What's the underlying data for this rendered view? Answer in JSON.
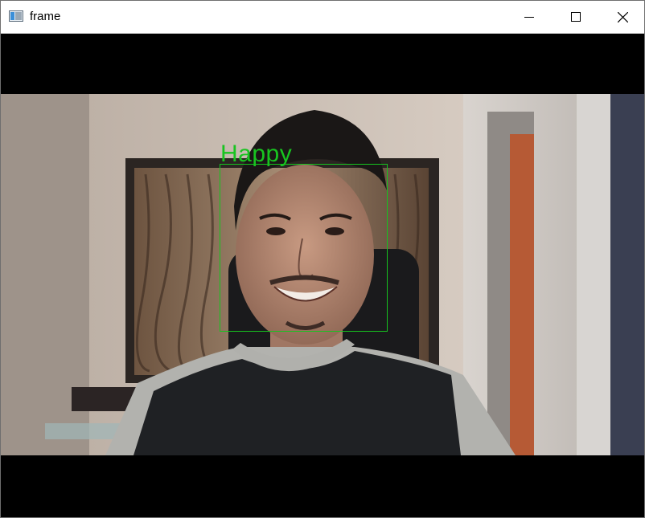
{
  "window": {
    "title": "frame",
    "icon": "opencv-window-icon"
  },
  "controls": {
    "minimize_icon": "minimize-icon",
    "maximize_icon": "maximize-icon",
    "close_icon": "close-icon"
  },
  "detection": {
    "label": "Happy",
    "box_color": "#16c41f"
  }
}
